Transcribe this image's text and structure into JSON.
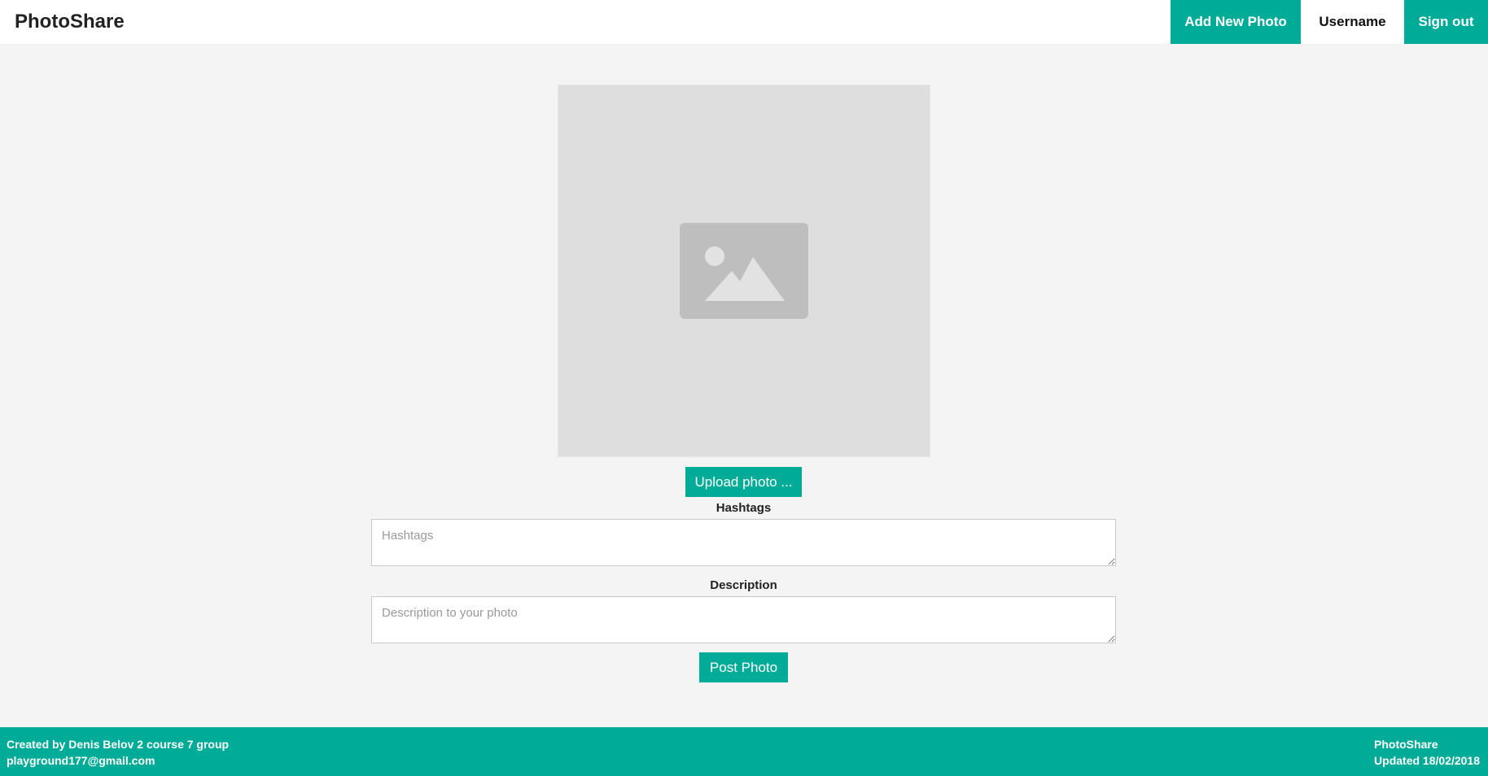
{
  "header": {
    "brand": "PhotoShare",
    "nav": {
      "add_photo": "Add New Photo",
      "username": "Username",
      "sign_out": "Sign out"
    }
  },
  "form": {
    "upload_label": "Upload photo ...",
    "hashtags_label": "Hashtags",
    "hashtags_placeholder": "Hashtags",
    "hashtags_value": "",
    "description_label": "Description",
    "description_placeholder": "Description to your photo",
    "description_value": "",
    "post_label": "Post Photo"
  },
  "footer": {
    "credit": "Created by Denis Belov 2 course 7 group",
    "email": "playground177@gmail.com",
    "app_name": "PhotoShare",
    "updated": "Updated 18/02/2018"
  },
  "colors": {
    "accent": "#00ab98",
    "background": "#f4f4f4",
    "preview_bg": "#dedede",
    "placeholder_icon": "#bebebe"
  },
  "icons": {
    "preview": "image-placeholder-icon"
  }
}
